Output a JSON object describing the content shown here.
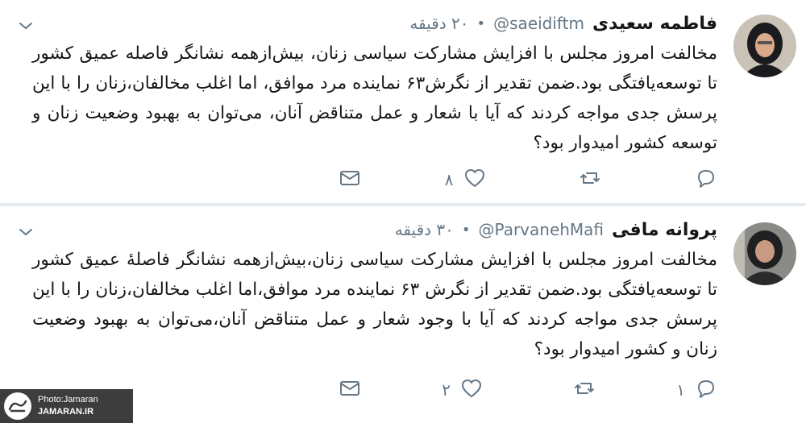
{
  "tweets": [
    {
      "name": "فاطمه سعیدی",
      "handle": "@saeidiftm",
      "dot": "•",
      "time": "۲۰ دقیقه",
      "text": "مخالفت امروز مجلس با افزایش مشارکت سیاسی زنان، بیش‌ازهمه نشانگر فاصله عمیق کشور تا توسعه‌یافتگی بود.ضمن تقدیر از نگرش۶۳ نماینده مرد موافق، اما اغلب مخالفان،زنان را با این پرسش جدی مواجه کردند که آیا با شعار و عمل متناقض آنان، می‌توان به بهبود وضعیت زنان و توسعه کشور امیدوار بود؟",
      "actions": {
        "reply_count": "",
        "retweet_count": "",
        "like_count": "۸"
      }
    },
    {
      "name": "پروانه مافی",
      "handle": "@ParvanehMafi",
      "dot": "•",
      "time": "۳۰ دقیقه",
      "text": "مخالفت امروز مجلس با افزایش مشارکت سیاسی زنان،بیش‌ازهمه نشانگر فاصلهٔ عمیق کشور تا توسعه‌یافتگی بود.ضمن تقدیر از نگرش ۶۳ نماینده مرد موافق،اما اغلب مخالفان،زنان را با این پرسش جدی مواجه کردند که آیا با وجود شعار و عمل متناقض آنان،می‌توان به بهبود وضعیت زنان و کشور امیدوار بود؟",
      "actions": {
        "reply_count": "۱",
        "retweet_count": "",
        "like_count": "۲"
      }
    }
  ],
  "icons": {
    "more": "chevron-down-icon",
    "reply": "reply-icon",
    "retweet": "retweet-icon",
    "like": "heart-icon",
    "dm": "envelope-icon"
  },
  "watermark": {
    "line1": "Photo:Jamaran",
    "line2": "JAMARAN.IR"
  },
  "colors": {
    "text": "#14171a",
    "muted": "#657786",
    "background": "#e6ecf0"
  }
}
